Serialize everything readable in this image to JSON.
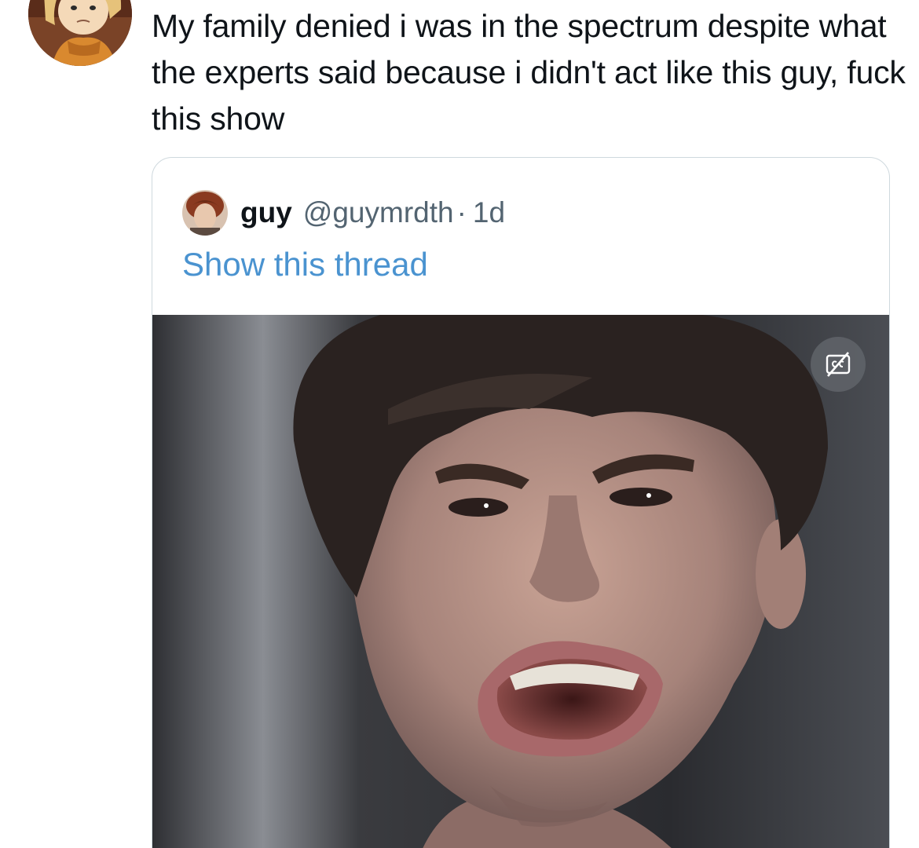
{
  "tweet": {
    "text": "My family denied i was in the spectrum despite what the experts said because i didn't act like this guy, fuck this show"
  },
  "quote": {
    "name": "guy",
    "handle": "@guymrdth",
    "separator": "·",
    "time": "1d",
    "show_thread": "Show this thread",
    "media_icon": "captions-off-icon"
  },
  "colors": {
    "text": "#0f1419",
    "secondary": "#536471",
    "link": "#4a93d0",
    "border": "#cfd9de"
  }
}
